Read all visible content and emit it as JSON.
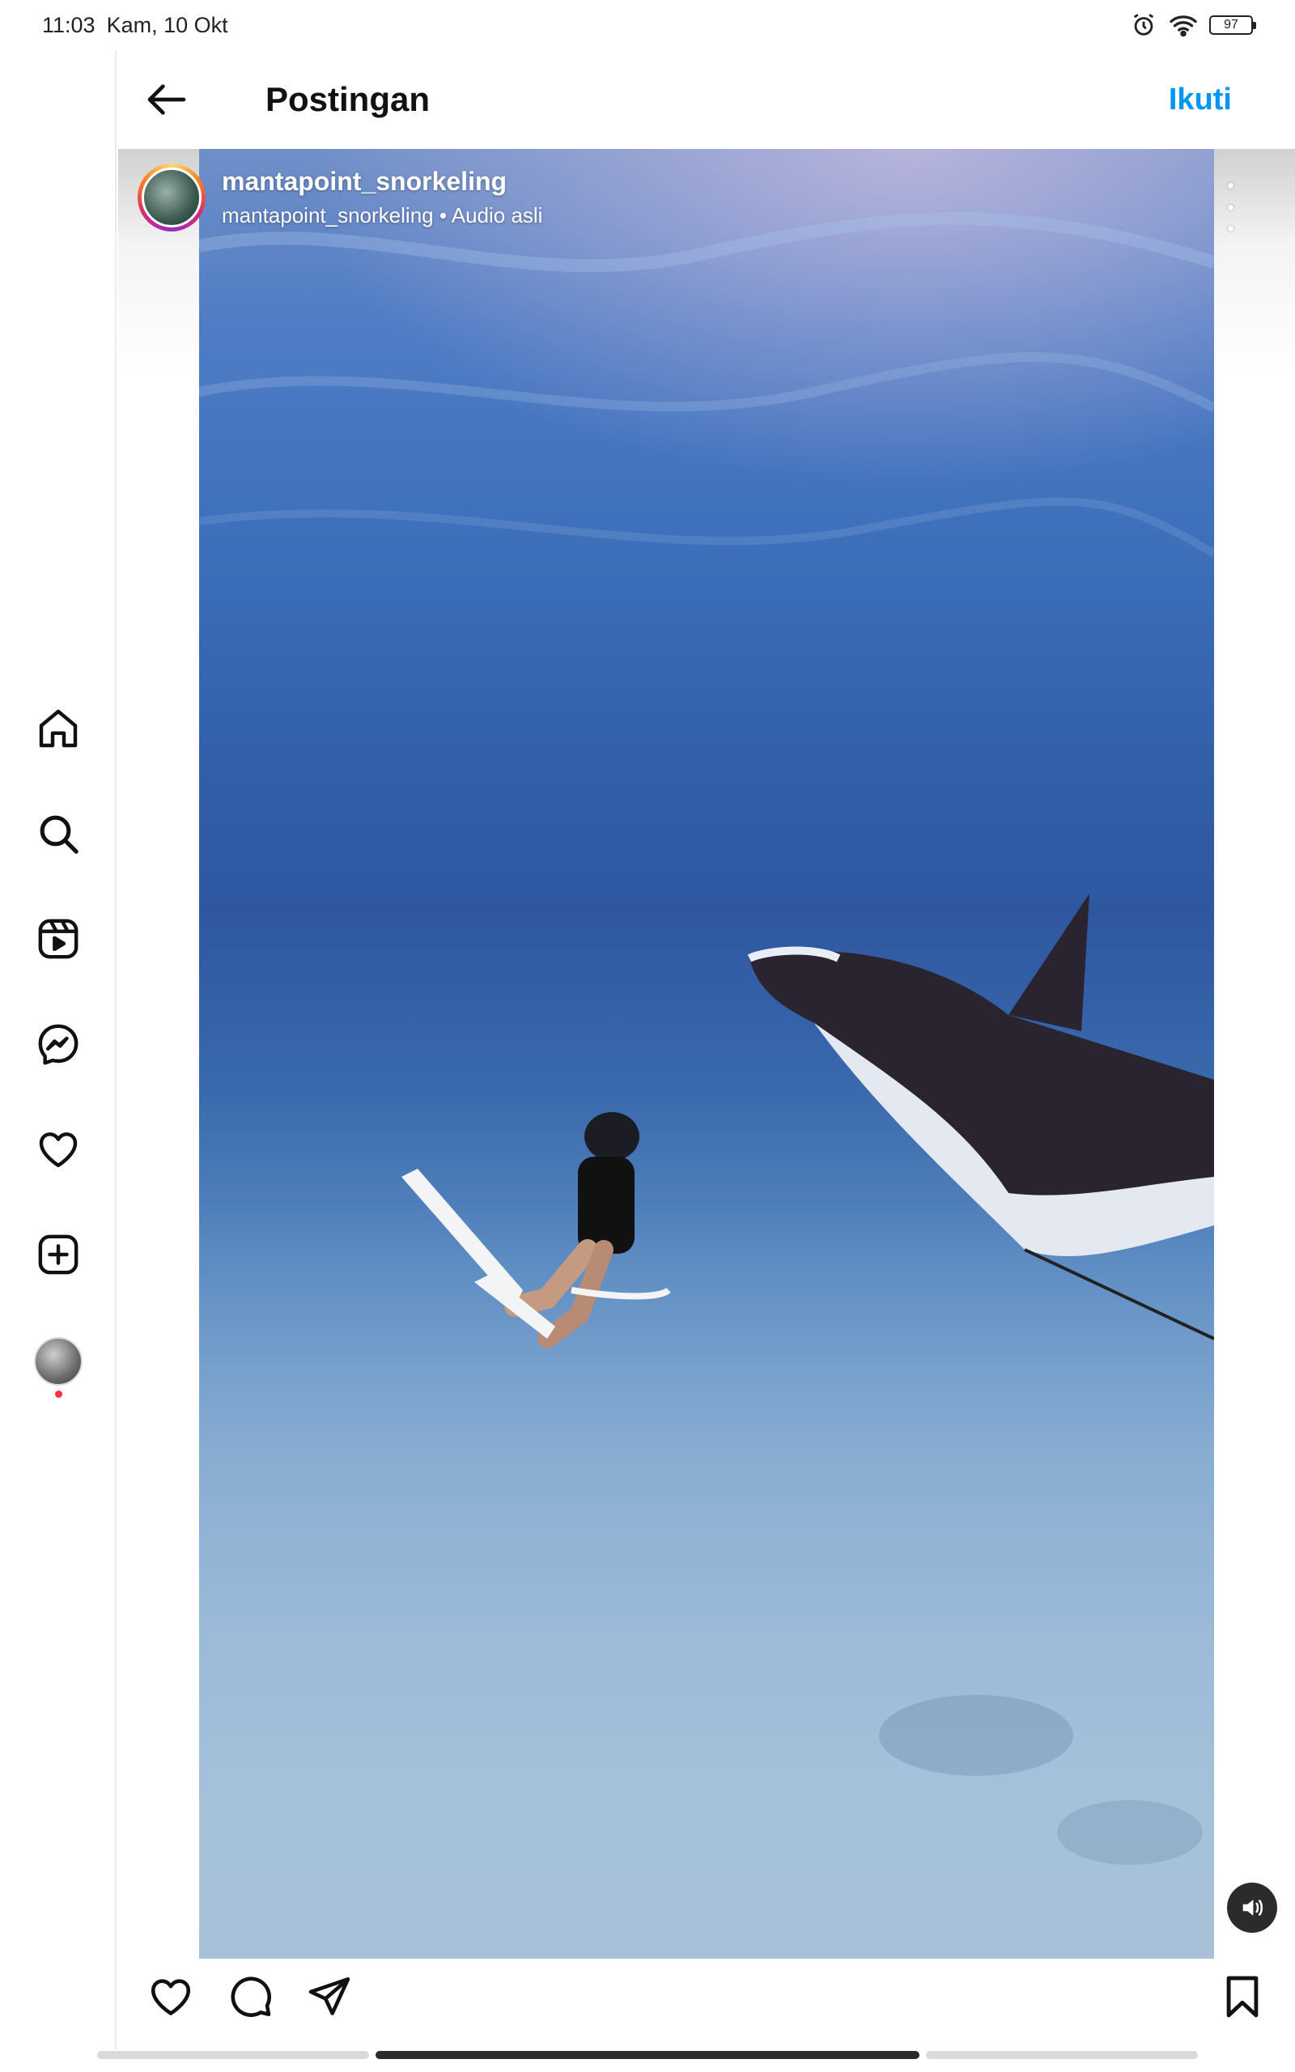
{
  "status_bar": {
    "time": "11:03",
    "date": "Kam, 10 Okt",
    "battery": "97",
    "icons": [
      "alarm-icon",
      "wifi-icon",
      "battery-icon"
    ]
  },
  "sidebar": {
    "items": [
      {
        "icon": "home-icon"
      },
      {
        "icon": "search-icon"
      },
      {
        "icon": "reels-icon"
      },
      {
        "icon": "messenger-icon"
      },
      {
        "icon": "heart-icon"
      },
      {
        "icon": "create-icon"
      },
      {
        "icon": "profile-avatar"
      }
    ]
  },
  "header": {
    "title": "Postingan",
    "follow_label": "Ikuti"
  },
  "post": {
    "username": "mantapoint_snorkeling",
    "subtitle": "mantapoint_snorkeling • Audio asli",
    "media_description_icons": [
      "more-options-icon",
      "sound-icon"
    ]
  },
  "actions": {
    "icons": [
      "like-icon",
      "comment-icon",
      "share-icon",
      "save-icon"
    ]
  },
  "colors": {
    "accent": "#0095f6",
    "notification": "#ff3040"
  }
}
